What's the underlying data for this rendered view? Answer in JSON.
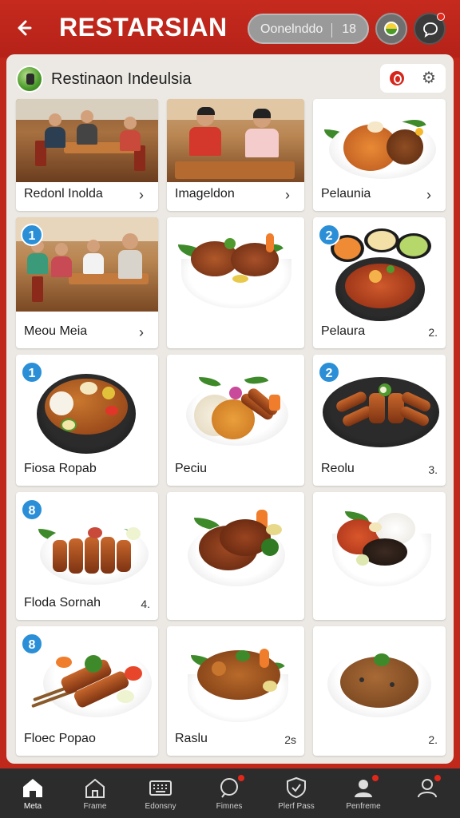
{
  "header": {
    "back_icon": "arrow-left-icon",
    "title": "RESTARSIAN",
    "search_text": "Oonelnddo",
    "search_count": "18",
    "logo_icon": "restaurant-logo-icon",
    "chat_icon": "chat-bubble-icon"
  },
  "restaurant": {
    "name": "Restinaon Indeulsia",
    "actions": [
      "tomato-icon",
      "gear-icon"
    ]
  },
  "cards": [
    {
      "label": "Redonl Inolda",
      "chevron": "›"
    },
    {
      "label": "Imageldon",
      "chevron": "›"
    },
    {
      "label": "Pelaunia",
      "chevron": "›"
    },
    {
      "label": "Meou Meia",
      "chevron": "›",
      "badge": "1"
    },
    {
      "label": ""
    },
    {
      "label": "Pelaura",
      "count": "2.",
      "badge": "2"
    },
    {
      "label": "Fiosa Ropab",
      "badge": "1"
    },
    {
      "label": "Peciu"
    },
    {
      "label": "Reolu",
      "count": "3.",
      "badge": "2"
    },
    {
      "label": "Floda Sornah",
      "count": "4.",
      "badge": "8"
    },
    {
      "label": ""
    },
    {
      "label": ""
    },
    {
      "label": "Floec Popao",
      "badge": "8"
    },
    {
      "label": "Raslu",
      "count": "2s"
    },
    {
      "label": "",
      "count": "2."
    }
  ],
  "bottom_nav": [
    {
      "label": "Meta",
      "icon": "home-icon",
      "active": true
    },
    {
      "label": "Frame",
      "icon": "house-outline-icon"
    },
    {
      "label": "Edonsny",
      "icon": "keyboard-icon"
    },
    {
      "label": "Fimnes",
      "icon": "search-chat-icon",
      "dot": true
    },
    {
      "label": "Plerf Pass",
      "icon": "shield-icon"
    },
    {
      "label": "Penfreme",
      "icon": "person-card-icon",
      "dot": true
    },
    {
      "label": "",
      "icon": "profile-icon",
      "dot": true
    }
  ],
  "colors": {
    "header_red": "#c62a1e",
    "badge_blue": "#2b8fd8",
    "nav_bg": "#2c2c2c",
    "panel_bg": "#ece9e4"
  }
}
